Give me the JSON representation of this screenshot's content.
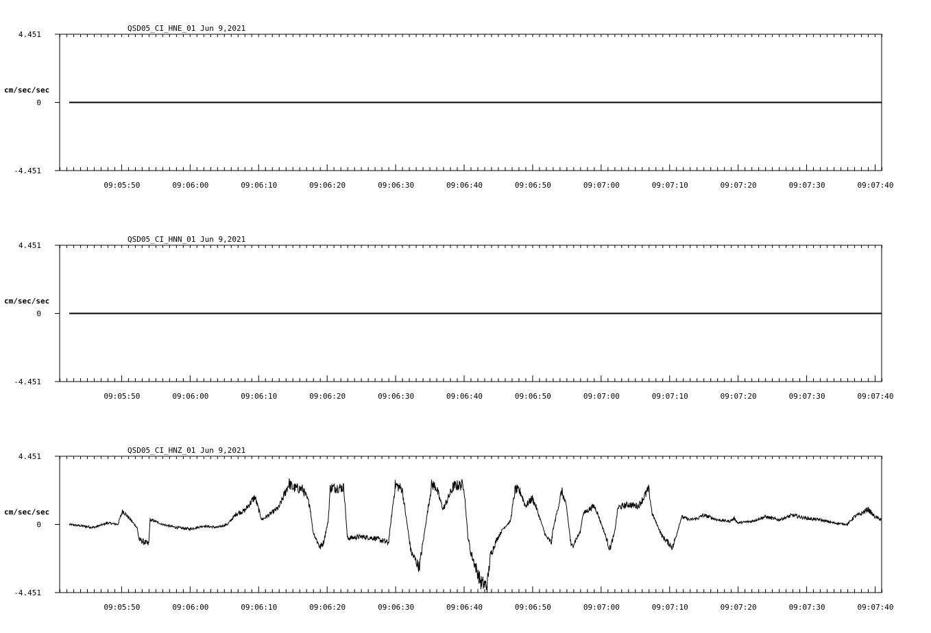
{
  "colors": {
    "background": "#ffffff",
    "trace": "#000000",
    "axis": "#000000"
  },
  "chart_data": [
    {
      "type": "line",
      "title": "QSD05_CI_HNE_01  Jun 9,2021",
      "ylabel": "cm/sec/sec",
      "ylim": [
        -4.451,
        4.451
      ],
      "yticks": [
        "4.451",
        "0",
        "-4.451"
      ],
      "xticks": [
        "09:05:50",
        "09:06:00",
        "09:06:10",
        "09:06:20",
        "09:06:30",
        "09:06:40",
        "09:06:50",
        "09:07:00",
        "09:07:10",
        "09:07:20",
        "09:07:30",
        "09:07:40"
      ],
      "x_range_seconds_after_0905": [
        41,
        161
      ],
      "series": [
        {
          "x": [
            42.4,
            161
          ],
          "y": [
            0,
            0
          ]
        }
      ]
    },
    {
      "type": "line",
      "title": "QSD05_CI_HNN_01  Jun 9,2021",
      "ylabel": "cm/sec/sec",
      "ylim": [
        -4.451,
        4.451
      ],
      "yticks": [
        "4.451",
        "0",
        "-4.451"
      ],
      "xticks": [
        "09:05:50",
        "09:06:00",
        "09:06:10",
        "09:06:20",
        "09:06:30",
        "09:06:40",
        "09:06:50",
        "09:07:00",
        "09:07:10",
        "09:07:20",
        "09:07:30",
        "09:07:40"
      ],
      "x_range_seconds_after_0905": [
        41,
        161
      ],
      "series": [
        {
          "x": [
            42.4,
            161
          ],
          "y": [
            0,
            0
          ]
        }
      ]
    },
    {
      "type": "line",
      "title": "QSD05_CI_HNZ_01  Jun 9,2021",
      "ylabel": "cm/sec/sec",
      "ylim": [
        -4.451,
        4.451
      ],
      "yticks": [
        "4.451",
        "0",
        "-4.451"
      ],
      "xticks": [
        "09:05:50",
        "09:06:00",
        "09:06:10",
        "09:06:20",
        "09:06:30",
        "09:06:40",
        "09:06:50",
        "09:07:00",
        "09:07:10",
        "09:07:20",
        "09:07:30",
        "09:07:40"
      ],
      "x_range_seconds_after_0905": [
        41,
        161
      ],
      "series": [
        {
          "x": [
            42.4,
            46,
            48,
            49.5,
            50.2,
            52.3,
            52.6,
            54,
            54.2,
            55,
            56,
            58,
            60,
            62,
            64,
            65.5,
            66.8,
            68,
            69.5,
            70.5,
            71.5,
            73,
            74.5,
            75,
            76.5,
            77.5,
            78,
            79,
            79.5,
            80.2,
            80.5,
            82.5,
            83,
            85,
            87,
            89,
            90,
            91,
            92.3,
            93.5,
            95.3,
            95.9,
            96.6,
            97,
            98.5,
            100,
            100.6,
            101,
            102.5,
            103.4,
            103.9,
            104.8,
            105.7,
            106.8,
            107.5,
            108.3,
            109,
            110,
            110.5,
            112,
            112.8,
            113,
            114.3,
            115,
            115.7,
            117,
            117.4,
            119,
            119.3,
            120.5,
            121.3,
            122,
            122.5,
            124,
            125.5,
            127,
            127.5,
            129,
            130.5,
            131.8,
            133,
            134.2,
            134.9,
            135.8,
            137,
            138.8,
            139.5,
            140,
            142,
            144,
            146,
            148,
            150,
            152,
            154,
            156,
            157,
            158,
            159,
            160,
            161
          ],
          "y": [
            0.0,
            -0.2,
            0.1,
            0.0,
            0.9,
            -0.2,
            -1.0,
            -1.3,
            0.3,
            0.2,
            0.0,
            -0.2,
            -0.3,
            -0.1,
            -0.2,
            0.0,
            0.7,
            0.9,
            1.8,
            0.3,
            0.6,
            1.1,
            2.7,
            2.4,
            2.3,
            1.3,
            -0.5,
            -1.5,
            -1.2,
            0.2,
            2.4,
            2.4,
            -0.9,
            -0.8,
            -0.9,
            -1.2,
            2.6,
            2.3,
            -1.8,
            -2.8,
            2.6,
            2.5,
            1.5,
            1.0,
            2.5,
            2.6,
            -0.8,
            -1.8,
            -3.8,
            -4.0,
            -2.0,
            -1.0,
            -0.3,
            0.2,
            2.3,
            2.1,
            1.2,
            1.7,
            1.2,
            -0.8,
            -1.2,
            -0.4,
            2.2,
            1.1,
            -1.5,
            -0.5,
            0.7,
            1.2,
            1.0,
            -0.5,
            -1.6,
            -0.6,
            1.1,
            1.3,
            1.2,
            2.3,
            0.7,
            -0.8,
            -1.5,
            0.5,
            0.3,
            0.4,
            0.6,
            0.5,
            0.3,
            0.2,
            0.4,
            0.1,
            0.2,
            0.5,
            0.3,
            0.6,
            0.4,
            0.3,
            0.1,
            0.0,
            0.5,
            0.7,
            1.0,
            0.5,
            0.3
          ]
        }
      ]
    }
  ]
}
